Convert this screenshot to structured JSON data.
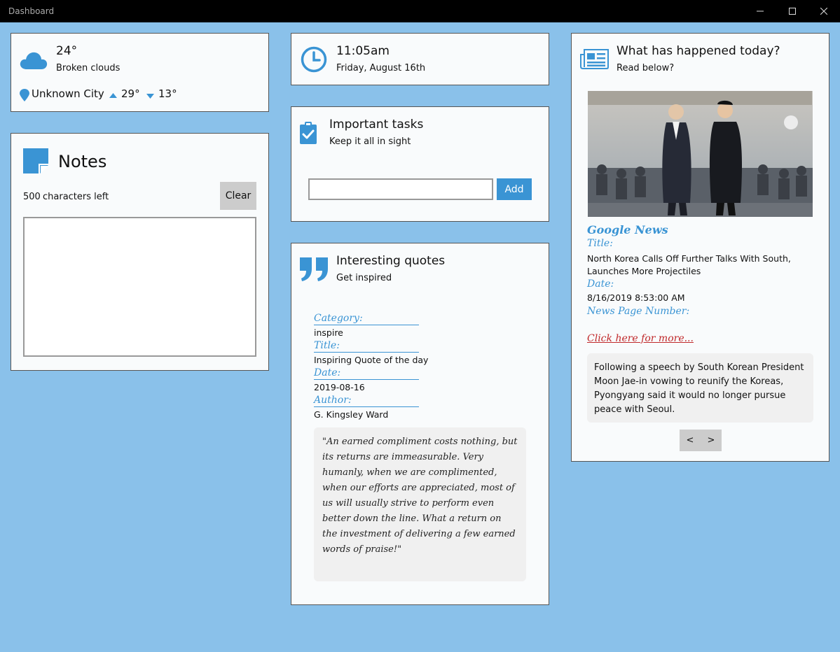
{
  "window": {
    "title": "Dashboard"
  },
  "weather": {
    "temperature": "24°",
    "condition": "Broken clouds",
    "city": "Unknown City",
    "high": "29°",
    "low": "13°"
  },
  "notes": {
    "title": "Notes",
    "chars_left": "500",
    "chars_left_suffix": "characters left",
    "clear_label": "Clear",
    "text": ""
  },
  "clock": {
    "time": "11:05am",
    "date": "Friday, August 16th"
  },
  "tasks": {
    "title": "Important tasks",
    "subtitle": "Keep it all in sight",
    "input_value": "",
    "add_label": "Add"
  },
  "quotes": {
    "title": "Interesting quotes",
    "subtitle": "Get inspired",
    "category_label": "Category:",
    "category": "inspire",
    "title_label": "Title:",
    "quote_title": "Inspiring Quote of the day",
    "date_label": "Date:",
    "date": "2019-08-16",
    "author_label": "Author:",
    "author": "G. Kingsley Ward",
    "text": "\"An earned compliment costs nothing, but its returns are immeasurable. Very humanly, when we are complimented, when our efforts are appreciated, most of us will usually strive to perform even better down the line. What a return on the investment of delivering a few earned words of praise!\""
  },
  "news": {
    "title": "What has happened today?",
    "subtitle": "Read below?",
    "source": "Google News",
    "title_label": "Title:",
    "headline": "North Korea Calls Off Further Talks With South, Launches More Projectiles",
    "date_label": "Date:",
    "date": "8/16/2019 8:53:00 AM",
    "page_label": "News Page Number:",
    "page_number": "",
    "more_link": "Click here for more...",
    "summary": "Following a speech by South Korean President Moon Jae-in vowing to reunify the Koreas, Pyongyang said it would no longer pursue peace with Seoul.",
    "prev_label": "<",
    "next_label": ">"
  },
  "colors": {
    "background": "#8ac1ea",
    "accent": "#3a94d4",
    "link": "#c0282a"
  }
}
